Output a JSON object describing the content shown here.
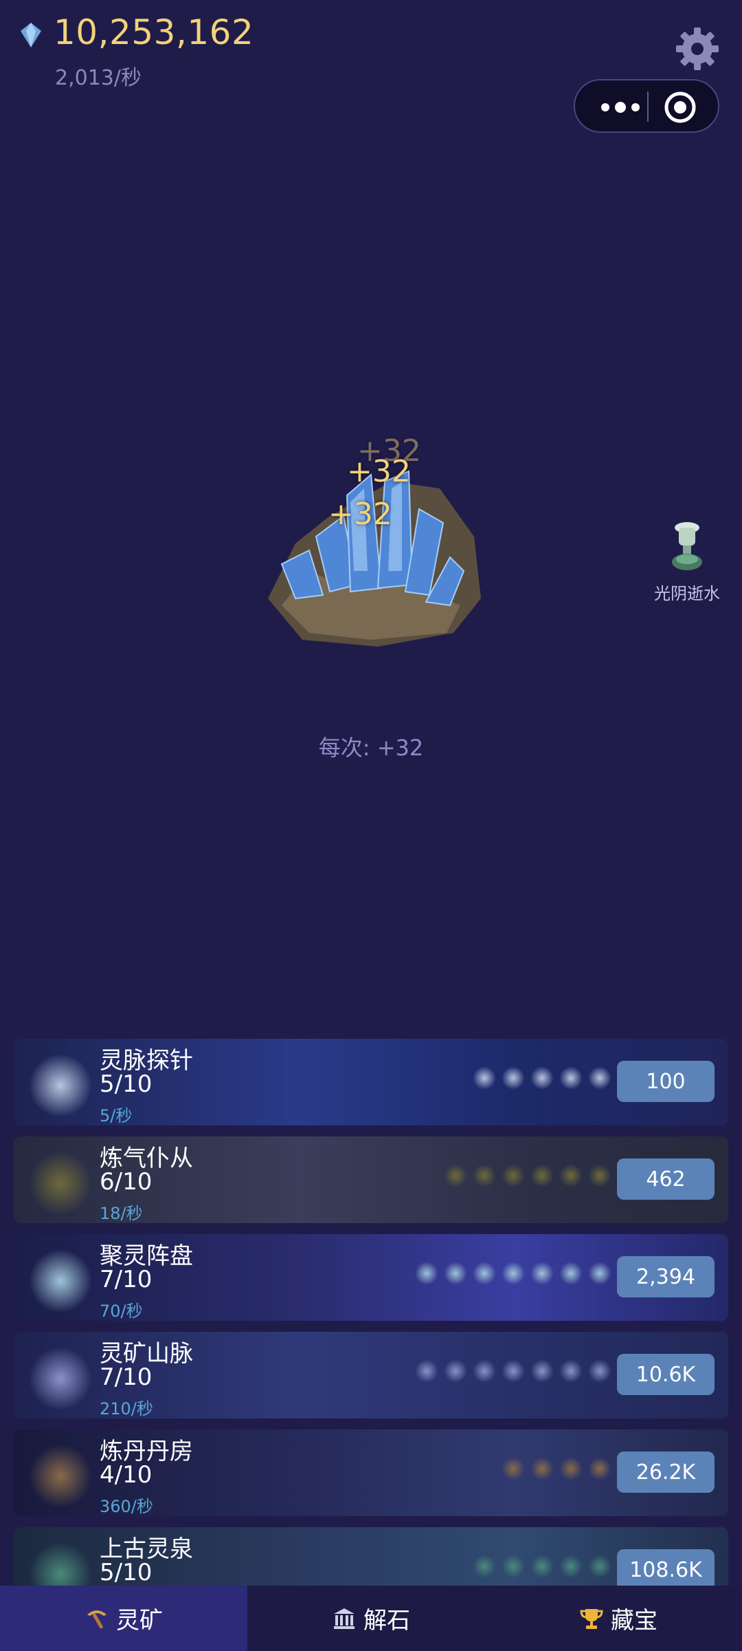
{
  "header": {
    "total": "10,253,162",
    "rate": "2,013/秒",
    "icons": [
      "gem-icon",
      "gear-icon",
      "more-dots-icon",
      "target-icon"
    ]
  },
  "main": {
    "float_numbers": [
      "+32",
      "+32",
      "+32"
    ],
    "per_click": "每次: +32",
    "boost": {
      "label": "光阴逝水",
      "icon": "potion-icon"
    }
  },
  "upgrades": [
    {
      "name": "灵脉探针",
      "level": "5/10",
      "production": "5/秒",
      "cost": "100",
      "minis": 5,
      "mini_color": "#b8c4e0"
    },
    {
      "name": "炼气仆从",
      "level": "6/10",
      "production": "18/秒",
      "cost": "462",
      "minis": 6,
      "mini_color": "#6e6a3a"
    },
    {
      "name": "聚灵阵盘",
      "level": "7/10",
      "production": "70/秒",
      "cost": "2,394",
      "minis": 7,
      "mini_color": "#9fc4d8"
    },
    {
      "name": "灵矿山脉",
      "level": "7/10",
      "production": "210/秒",
      "cost": "10.6K",
      "minis": 7,
      "mini_color": "#8a92c8"
    },
    {
      "name": "炼丹丹房",
      "level": "4/10",
      "production": "360/秒",
      "cost": "26.2K",
      "minis": 4,
      "mini_color": "#8a6a4a"
    },
    {
      "name": "上古灵泉",
      "level": "5/10",
      "production": "",
      "cost": "108.6K",
      "minis": 5,
      "mini_color": "#4a8a7a"
    }
  ],
  "tabs": [
    {
      "label": "灵矿",
      "icon": "pickaxe-icon",
      "active": true
    },
    {
      "label": "解石",
      "icon": "temple-icon",
      "active": false
    },
    {
      "label": "藏宝",
      "icon": "trophy-icon",
      "active": false
    }
  ],
  "colors": {
    "background": "#1f1c4a",
    "gold": "#f3d27a",
    "button": "#5b83b8",
    "tab_active": "#2d2a78"
  }
}
